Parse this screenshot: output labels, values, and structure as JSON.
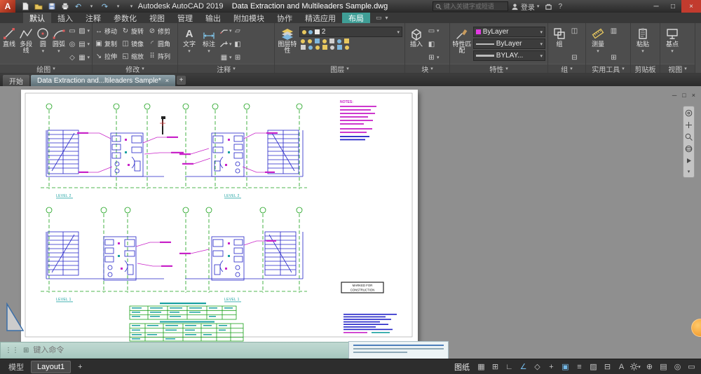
{
  "colors": {
    "context_tab_teal": "#3f9e96",
    "property_swatch_magenta": "#e33ae3",
    "badge_orange": "#f09a28",
    "plan_blue": "#2323c8",
    "plan_green": "#18a018",
    "plan_magenta": "#c822c8",
    "plan_cyan": "#18a0a0"
  },
  "titlebar": {
    "app_name": "Autodesk AutoCAD 2019",
    "doc_name": "Data Extraction and Multileaders Sample.dwg",
    "search_placeholder": "键入关键字或短语",
    "signin_label": "登录"
  },
  "ribbon": {
    "tabs": [
      {
        "label": "默认"
      },
      {
        "label": "插入"
      },
      {
        "label": "注释"
      },
      {
        "label": "参数化"
      },
      {
        "label": "视图"
      },
      {
        "label": "管理"
      },
      {
        "label": "输出"
      },
      {
        "label": "附加模块"
      },
      {
        "label": "协作"
      },
      {
        "label": "精选应用"
      },
      {
        "label": "布局"
      }
    ],
    "draw": {
      "label": "绘图",
      "line": "直线",
      "polyline": "多段线",
      "circle": "圆",
      "arc": "圆弧"
    },
    "modify": {
      "label": "修改",
      "move": "移动",
      "rotate": "旋转",
      "trim": "修剪",
      "copy": "复制",
      "mirror": "镜像",
      "fillet": "圆角",
      "stretch": "拉伸",
      "scale": "缩放",
      "array": "阵列"
    },
    "annotate": {
      "label": "注释",
      "text": "文字",
      "dimension": "标注"
    },
    "layers": {
      "label": "图层",
      "properties": "图层特性",
      "current_layer": "2"
    },
    "block": {
      "label": "块",
      "insert": "插入"
    },
    "properties": {
      "label": "特性",
      "match": "特性匹配",
      "color": "ByLayer",
      "linetype": "ByLayer",
      "lineweight": "BYLAY..."
    },
    "groups": {
      "label": "组",
      "group": "组"
    },
    "utilities": {
      "label": "实用工具",
      "measure": "测量"
    },
    "clipboard": {
      "label": "剪贴板",
      "paste": "粘贴"
    },
    "view": {
      "label": "视图",
      "base": "基点"
    }
  },
  "file_tabs": {
    "start": "开始",
    "document": "Data Extraction and...ltileaders Sample*"
  },
  "drawing": {
    "notes_title": "NOTES:",
    "stamp_line1": "MARKED FOR",
    "stamp_line2": "CONSTRUCTION",
    "level_top_left": "LEVEL 2",
    "level_top_right": "LEVEL 2",
    "level_bottom_left": "LEVEL 1",
    "level_bottom_right": "LEVEL 1"
  },
  "command": {
    "placeholder": "键入命令"
  },
  "status": {
    "model_tab": "模型",
    "layout_tab": "Layout1",
    "space_mode": "图纸"
  }
}
